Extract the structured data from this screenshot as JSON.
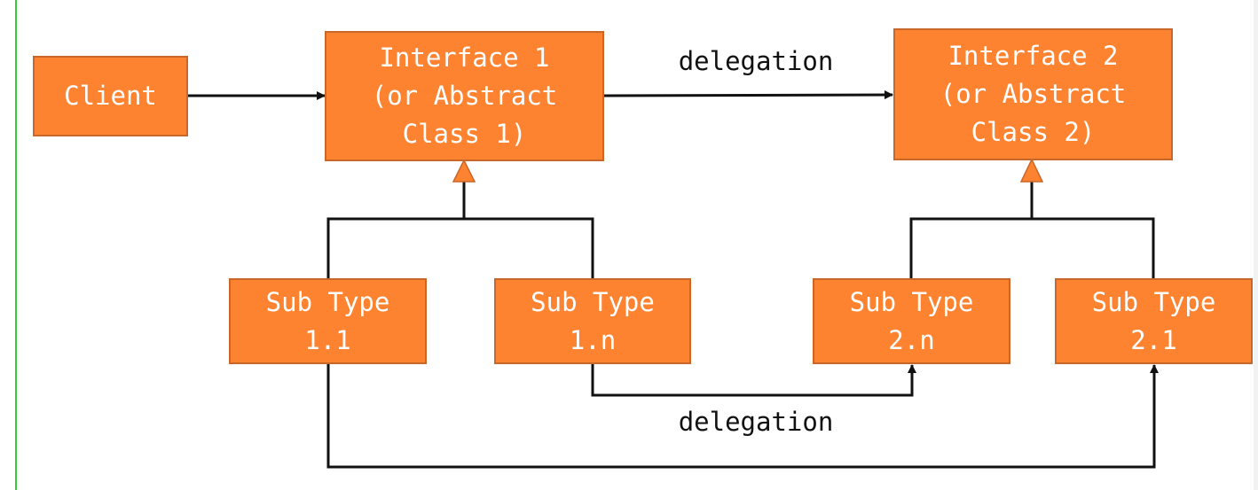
{
  "nodes": {
    "client": "Client",
    "interface1": "Interface 1\n(or Abstract\nClass 1)",
    "interface2": "Interface 2\n(or Abstract\nClass 2)",
    "sub11": "Sub Type\n1.1",
    "sub1n": "Sub Type\n1.n",
    "sub2n": "Sub Type\n2.n",
    "sub21": "Sub Type\n2.1"
  },
  "edges": {
    "top_label": "delegation",
    "bottom_label": "delegation"
  },
  "colors": {
    "box_fill": "#fe8330",
    "box_border": "#c9662a",
    "line": "#111111"
  }
}
